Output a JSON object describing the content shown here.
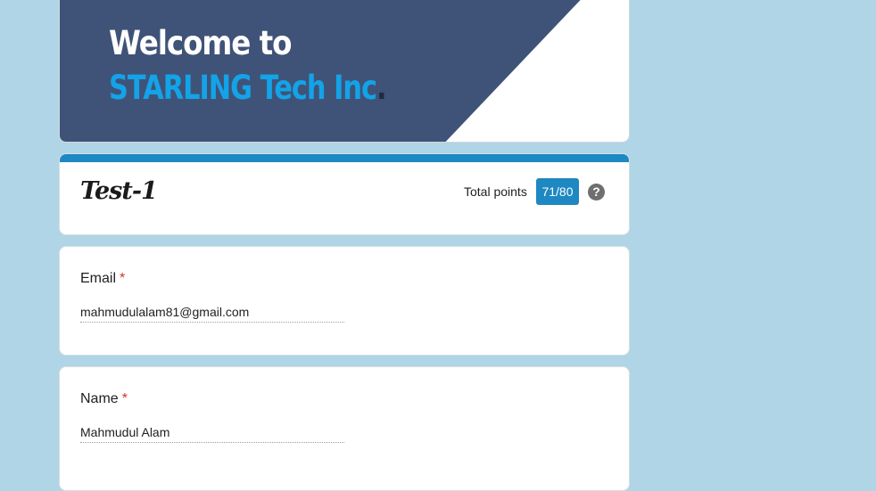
{
  "banner": {
    "line1": "Welcome to",
    "line2": "STARLING Tech Inc",
    "line2_suffix": ".",
    "colors": {
      "background": "#3f5378",
      "accent": "#13a3e8"
    }
  },
  "header": {
    "title": "Test-1",
    "points_label": "Total points",
    "points_value": "71/80",
    "help_icon": "help-circle-icon"
  },
  "fields": [
    {
      "label": "Email",
      "required_mark": "*",
      "value": "mahmudulalam81@gmail.com"
    },
    {
      "label": "Name",
      "required_mark": "*",
      "value": "Mahmudul Alam"
    }
  ]
}
